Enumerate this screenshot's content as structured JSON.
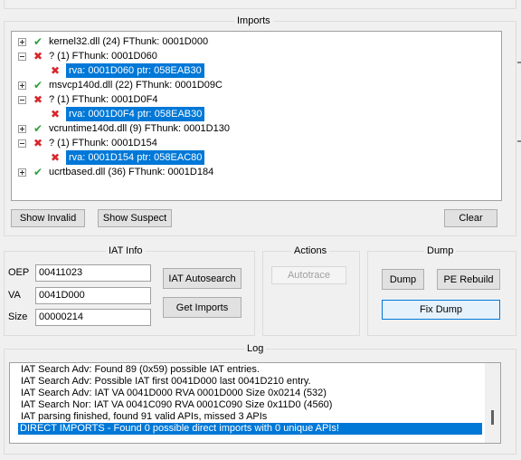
{
  "imports": {
    "title": "Imports",
    "tree": [
      {
        "status": "ok",
        "expander": "plus",
        "label": "kernel32.dll (24) FThunk: 0001D000"
      },
      {
        "status": "bad",
        "expander": "minus",
        "label": "? (1) FThunk: 0001D060"
      },
      {
        "status": "bad",
        "child": true,
        "selected": true,
        "label": "rva: 0001D060 ptr: 058EAB30"
      },
      {
        "status": "ok",
        "expander": "plus",
        "label": "msvcp140d.dll (22) FThunk: 0001D09C"
      },
      {
        "status": "bad",
        "expander": "minus",
        "label": "? (1) FThunk: 0001D0F4"
      },
      {
        "status": "bad",
        "child": true,
        "selected": true,
        "label": "rva: 0001D0F4 ptr: 058EAB30"
      },
      {
        "status": "ok",
        "expander": "plus",
        "label": "vcruntime140d.dll (9) FThunk: 0001D130"
      },
      {
        "status": "bad",
        "expander": "minus",
        "label": "? (1) FThunk: 0001D154"
      },
      {
        "status": "bad",
        "child": true,
        "selected": true,
        "label": "rva: 0001D154 ptr: 058EAC80"
      },
      {
        "status": "ok",
        "expander": "plus",
        "label": "ucrtbased.dll (36) FThunk: 0001D184"
      }
    ],
    "show_invalid": "Show Invalid",
    "show_suspect": "Show Suspect",
    "clear": "Clear"
  },
  "iat_info": {
    "title": "IAT Info",
    "oep_label": "OEP",
    "oep_value": "00411023",
    "va_label": "VA",
    "va_value": "0041D000",
    "size_label": "Size",
    "size_value": "00000214",
    "autosearch": "IAT Autosearch",
    "get_imports": "Get Imports"
  },
  "actions": {
    "title": "Actions",
    "autotrace": "Autotrace"
  },
  "dump": {
    "title": "Dump",
    "dump": "Dump",
    "pe_rebuild": "PE Rebuild",
    "fix_dump": "Fix Dump"
  },
  "log": {
    "title": "Log",
    "lines": [
      "IAT Search Adv: Found 89 (0x59) possible IAT entries.",
      "IAT Search Adv: Possible IAT first 0041D000 last 0041D210 entry.",
      "IAT Search Adv: IAT VA 0041D000 RVA 0001D000 Size 0x0214 (532)",
      "IAT Search Nor: IAT VA 0041C090 RVA 0001C090 Size 0x11D0 (4560)",
      "IAT parsing finished, found 91 valid APIs, missed 3 APIs",
      "DIRECT IMPORTS - Found 0 possible direct imports with 0 unique APIs!"
    ],
    "selected_index": 5
  },
  "icons": {
    "ok": "checkmark-icon",
    "bad": "cross-icon"
  },
  "colors": {
    "selection": "#0078d7",
    "ok": "#2e9e3c",
    "bad": "#d8262a"
  }
}
